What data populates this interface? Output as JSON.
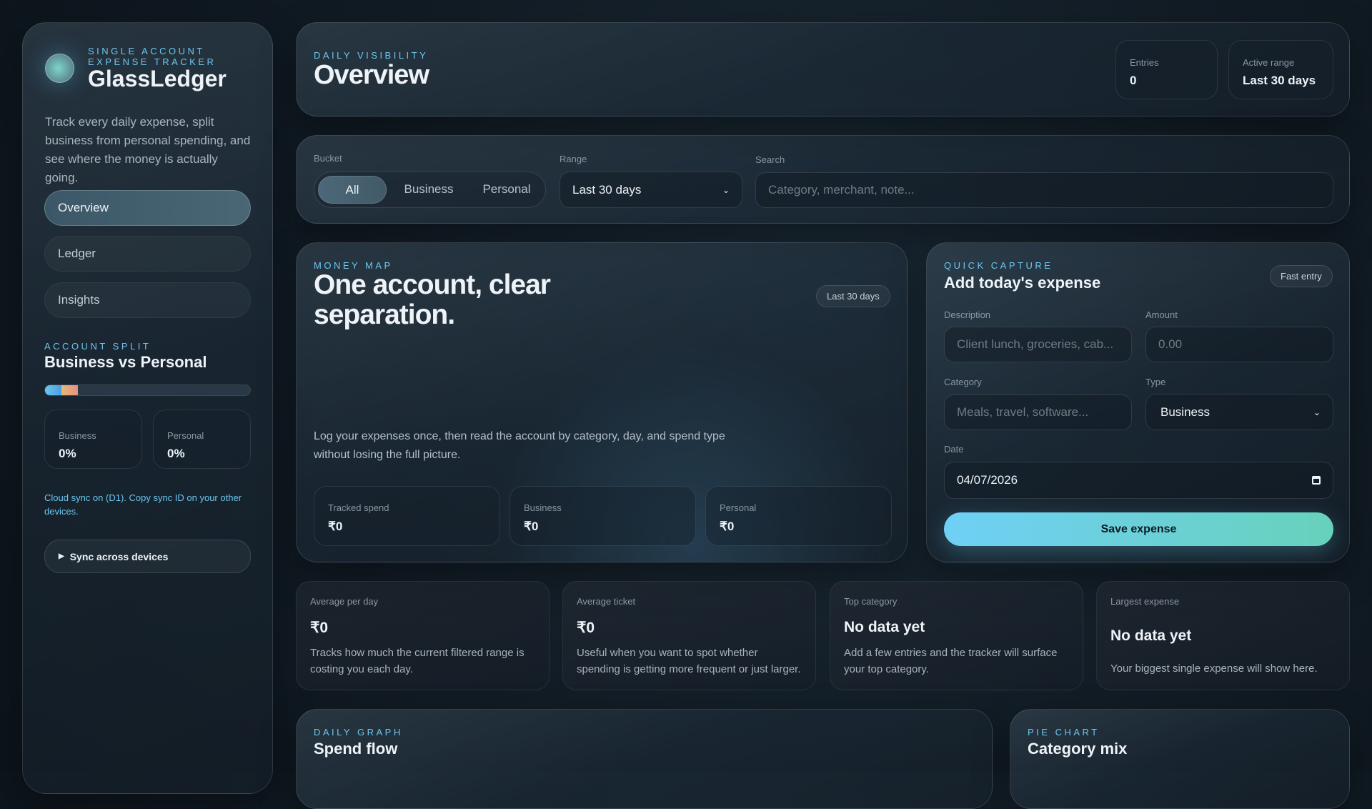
{
  "sidebar": {
    "eyebrow": "Single account expense tracker",
    "title": "GlassLedger",
    "description": "Track every daily expense, split business from personal spending, and see where the money is actually going.",
    "nav": [
      {
        "label": "Overview",
        "active": true
      },
      {
        "label": "Ledger"
      },
      {
        "label": "Insights"
      }
    ],
    "split": {
      "eyebrow": "Account split",
      "title": "Business vs Personal",
      "business_label": "Business",
      "business_value": "0%",
      "personal_label": "Personal",
      "personal_value": "0%"
    },
    "sync_note": "Cloud sync on (D1). Copy sync ID on your other devices.",
    "sync_button": "Sync across devices"
  },
  "header": {
    "eyebrow": "Daily visibility",
    "title": "Overview",
    "entries_label": "Entries",
    "entries_value": "0",
    "range_label": "Active range",
    "range_value": "Last 30 days"
  },
  "filters": {
    "bucket_label": "Bucket",
    "buckets": [
      "All",
      "Business",
      "Personal"
    ],
    "active_bucket": "All",
    "range_label": "Range",
    "range_value": "Last 30 days",
    "search_label": "Search",
    "search_placeholder": "Category, merchant, note..."
  },
  "money_map": {
    "eyebrow": "Money map",
    "title": "One account, clear separation.",
    "badge": "Last 30 days",
    "description": "Log your expenses once, then read the account by category, day, and spend type without losing the full picture.",
    "tiles": [
      {
        "label": "Tracked spend",
        "value": "₹0"
      },
      {
        "label": "Business",
        "value": "₹0"
      },
      {
        "label": "Personal",
        "value": "₹0"
      }
    ]
  },
  "quick_capture": {
    "eyebrow": "Quick capture",
    "title": "Add today's expense",
    "badge": "Fast entry",
    "description_label": "Description",
    "description_placeholder": "Client lunch, groceries, cab...",
    "amount_label": "Amount",
    "amount_placeholder": "0.00",
    "category_label": "Category",
    "category_placeholder": "Meals, travel, software...",
    "type_label": "Type",
    "type_value": "Business",
    "date_label": "Date",
    "date_value": "04/07/2026",
    "save_label": "Save expense"
  },
  "stats": [
    {
      "label": "Average per day",
      "value": "₹0",
      "description": "Tracks how much the current filtered range is costing you each day."
    },
    {
      "label": "Average ticket",
      "value": "₹0",
      "description": "Useful when you want to spot whether spending is getting more frequent or just larger."
    },
    {
      "label": "Top category",
      "value": "No data yet",
      "description": "Add a few entries and the tracker will surface your top category."
    },
    {
      "label": "Largest expense",
      "value": "No data yet",
      "description": "Your biggest single expense will show here."
    }
  ],
  "daily_graph": {
    "eyebrow": "Daily graph",
    "title": "Spend flow"
  },
  "pie_chart": {
    "eyebrow": "Pie chart",
    "title": "Category mix"
  }
}
